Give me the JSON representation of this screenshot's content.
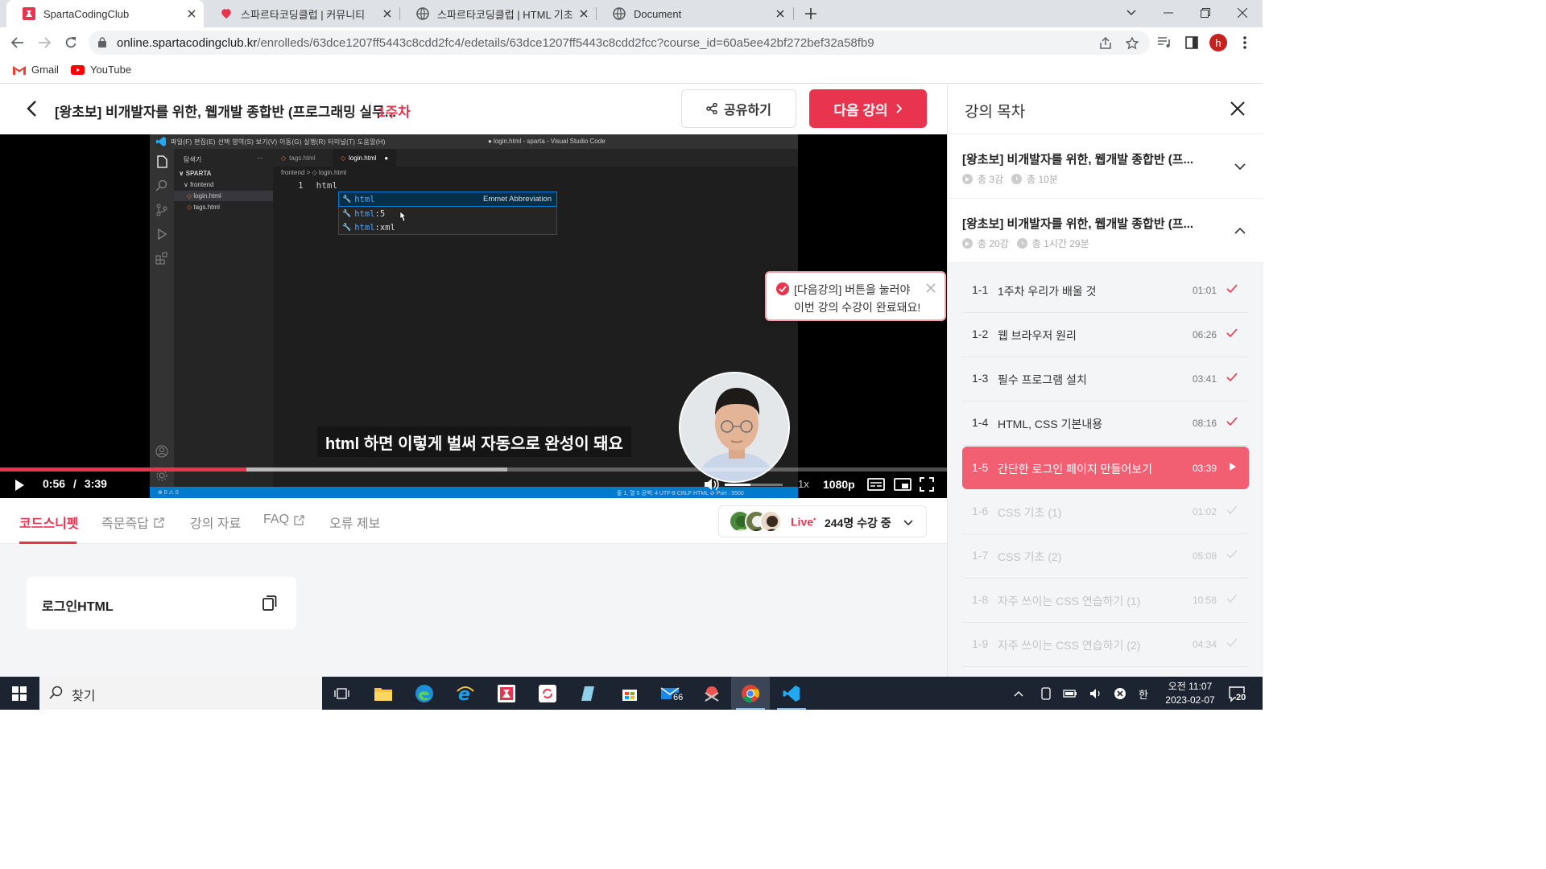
{
  "browser": {
    "tabs": [
      {
        "title": "SpartaCodingClub",
        "active": true
      },
      {
        "title": "스파르타코딩클럽 | 커뮤니티",
        "active": false
      },
      {
        "title": "스파르타코딩클럽 | HTML 기초",
        "active": false
      },
      {
        "title": "Document",
        "active": false
      }
    ],
    "url_host": "online.spartacodingclub.kr",
    "url_path": "/enrolleds/63dce1207ff5443c8cdd2fc4/edetails/63dce1207ff5443c8cdd2fcc?course_id=60a5ee42bf272bef32a58fb9",
    "profile_initial": "h",
    "bookmarks": [
      {
        "label": "Gmail",
        "icon": "gmail-icon"
      },
      {
        "label": "YouTube",
        "icon": "youtube-icon"
      }
    ]
  },
  "header": {
    "course_title": "[왕초보] 비개발자를 위한, 웹개발 종합반 (프로그래밍 실무...",
    "week": "1주차",
    "share_label": "공유하기",
    "next_label": "다음 강의"
  },
  "video": {
    "vscode": {
      "menu": "파일(F)   편집(E)   선택 영역(S)   보기(V)   이동(G)   실행(R)   터미널(T)   도움말(H)",
      "window_title": "● login.html - sparta - Visual Studio Code",
      "explorer_label": "탐색기",
      "explorer_root": "SPARTA",
      "folder": "frontend",
      "files": [
        "login.html",
        "tags.html"
      ],
      "editor_tabs": [
        "tags.html",
        "login.html"
      ],
      "breadcrumb": "frontend >  ◇ login.html",
      "line_number": "1",
      "line_text": "html",
      "suggestions": [
        {
          "match": "html",
          "rest": "",
          "desc": "Emmet Abbreviation"
        },
        {
          "match": "html",
          "rest": ":5",
          "desc": ""
        },
        {
          "match": "html",
          "rest": ":xml",
          "desc": ""
        }
      ],
      "status_left": "⊗ 0 ⚠ 0",
      "status_right": "줄 1, 열 5    공백: 4    UTF-8    CRLF    HTML    ⊘ Port : 5500"
    },
    "subtitle": "html 하면 이렇게 벌써 자동으로 완성이 돼요",
    "toast_line1": "[다음강의] 버튼을 눌러야",
    "toast_line2": "이번 강의 수강이 완료돼요!",
    "current_time": "0:56",
    "duration": "3:39",
    "played_fraction": 0.26,
    "buffered_fraction": 0.536,
    "volume_fraction": 0.45,
    "speed": "1x",
    "quality": "1080p"
  },
  "lower_tabs": [
    {
      "label": "코드스니펫",
      "active": true,
      "external": false
    },
    {
      "label": "즉문즉답",
      "active": false,
      "external": true
    },
    {
      "label": "강의 자료",
      "active": false,
      "external": false
    },
    {
      "label": "FAQ",
      "active": false,
      "external": true
    },
    {
      "label": "오류 제보",
      "active": false,
      "external": false
    }
  ],
  "live": {
    "label": "Live",
    "count_text": "244명 수강 중"
  },
  "snippet": {
    "name": "로그인HTML"
  },
  "toc": {
    "title": "강의 목차",
    "chapters": [
      {
        "title": "[왕초보] 비개발자를 위한, 웹개발 종합반 (프...",
        "count": "총 3강",
        "time": "총 10분",
        "expanded": false
      },
      {
        "title": "[왕초보] 비개발자를 위한, 웹개발 종합반 (프...",
        "count": "총 20강",
        "time": "총 1시간 29분",
        "expanded": true
      }
    ],
    "lessons": [
      {
        "num": "1-1",
        "title": "1주차 우리가 배울 것",
        "duration": "01:01",
        "state": "done"
      },
      {
        "num": "1-2",
        "title": "웹 브라우저 원리",
        "duration": "06:26",
        "state": "done"
      },
      {
        "num": "1-3",
        "title": "필수 프로그램 설치",
        "duration": "03:41",
        "state": "done"
      },
      {
        "num": "1-4",
        "title": "HTML, CSS 기본내용",
        "duration": "08:16",
        "state": "done"
      },
      {
        "num": "1-5",
        "title": "간단한 로그인 페이지 만들어보기",
        "duration": "03:39",
        "state": "active"
      },
      {
        "num": "1-6",
        "title": "CSS 기초 (1)",
        "duration": "01:02",
        "state": "todo"
      },
      {
        "num": "1-7",
        "title": "CSS 기초 (2)",
        "duration": "05:08",
        "state": "todo"
      },
      {
        "num": "1-8",
        "title": "자주 쓰이는 CSS 연습하기 (1)",
        "duration": "10:58",
        "state": "todo"
      },
      {
        "num": "1-9",
        "title": "자주 쓰이는 CSS 연습하기 (2)",
        "duration": "04:34",
        "state": "todo"
      }
    ]
  },
  "taskbar": {
    "search_label": "찾기",
    "mail_badge": "66",
    "ime": "한",
    "time": "오전 11:07",
    "date": "2023-02-07",
    "notif_count": "20"
  },
  "colors": {
    "brand": "#e8344e",
    "active_lesson": "#f35f72"
  }
}
